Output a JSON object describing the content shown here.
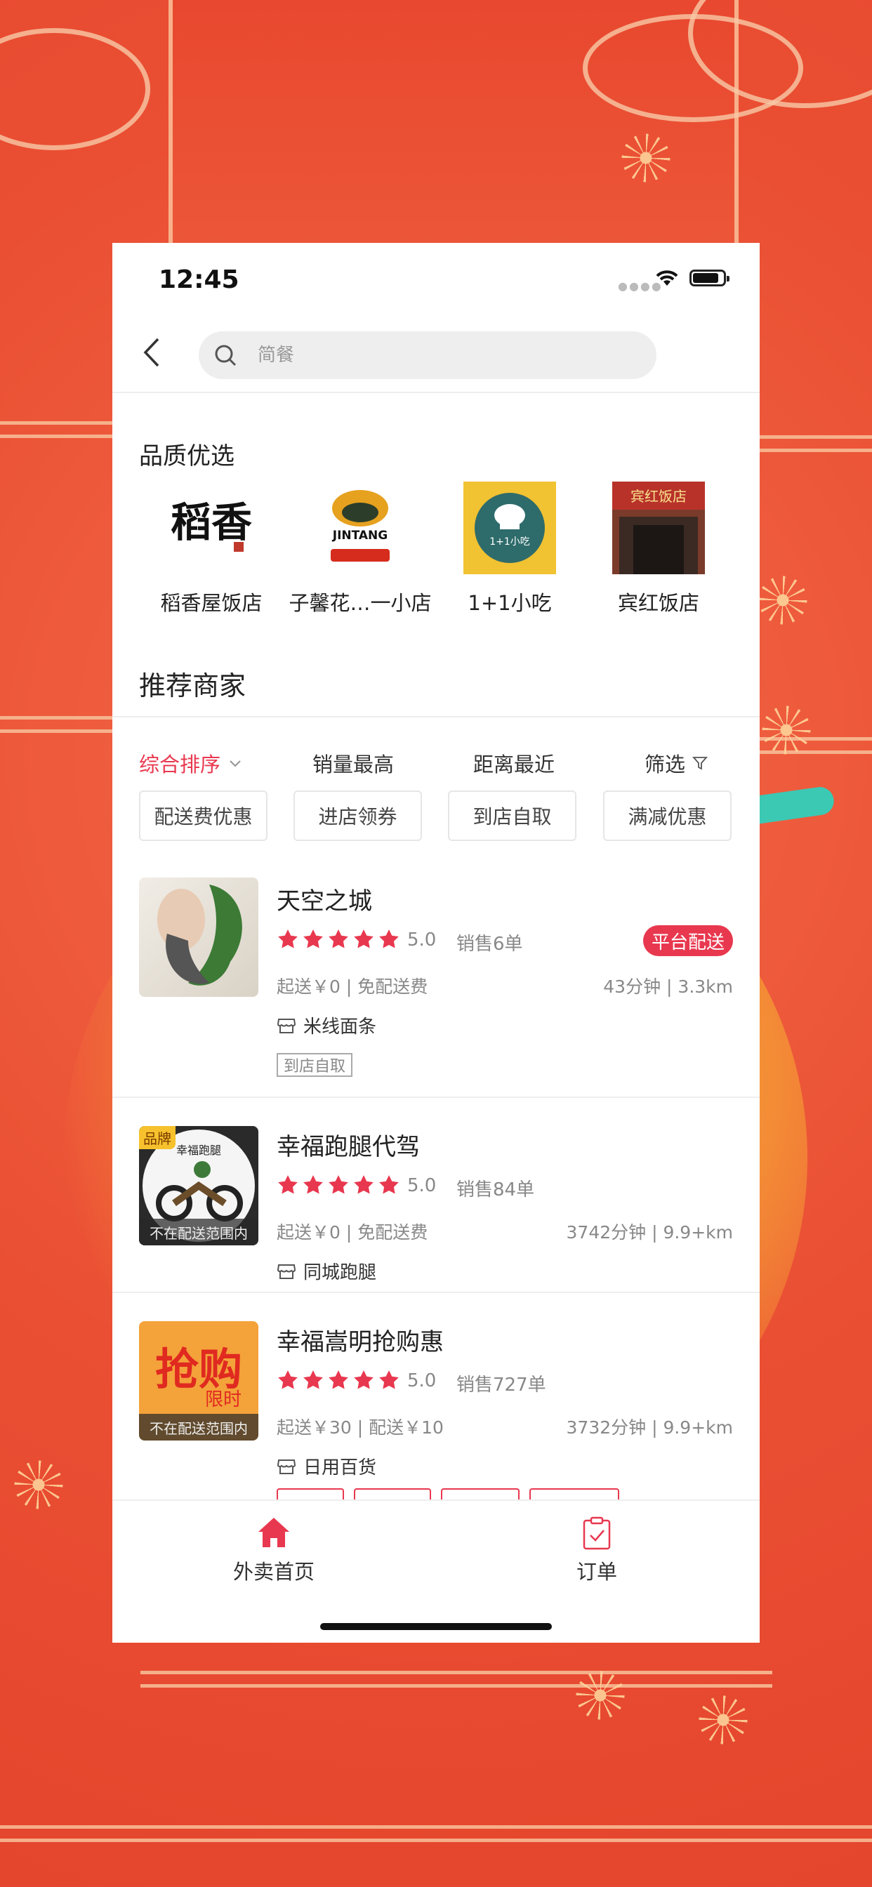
{
  "status_bar": {
    "time": "12:45"
  },
  "search": {
    "placeholder": "简餐"
  },
  "quality": {
    "title": "品质优选",
    "items": [
      {
        "name": "稻香屋饭店",
        "logo_text": "稻香"
      },
      {
        "name": "子馨花…一小店",
        "logo_text": "JINTANG"
      },
      {
        "name": "1+1小吃",
        "logo_text": "1+1小吃"
      },
      {
        "name": "宾红饭店",
        "logo_text": "宾红饭店"
      }
    ]
  },
  "recommend": {
    "title": "推荐商家",
    "sort": {
      "comprehensive": "综合排序",
      "sales": "销量最高",
      "distance": "距离最近",
      "filter": "筛选"
    },
    "chips": [
      "配送费优惠",
      "进店领券",
      "到店自取",
      "满减优惠"
    ],
    "stores": [
      {
        "name": "天空之城",
        "score": "5.0",
        "sales": "销售6单",
        "badge": "平台配送",
        "delivery": "起送￥0 | 免配送费",
        "eta": "43分钟 | 3.3km",
        "category": "米线面条",
        "tag": "到店自取",
        "logo_overlay": ""
      },
      {
        "name": "幸福跑腿代驾",
        "score": "5.0",
        "sales": "销售84单",
        "delivery": "起送￥0 | 免配送费",
        "eta": "3742分钟 | 9.9+km",
        "category": "同城跑腿",
        "brand": "品牌",
        "logo_text": "幸福跑腿",
        "logo_overlay": "不在配送范围内"
      },
      {
        "name": "幸福嵩明抢购惠",
        "score": "5.0",
        "sales": "销售727单",
        "delivery": "起送￥30 | 配送￥10",
        "eta": "3732分钟 | 9.9+km",
        "category": "日用百货",
        "logo_text": "抢购",
        "logo_sub": "限时",
        "logo_overlay": "不在配送范围内"
      }
    ]
  },
  "tabbar": {
    "home": "外卖首页",
    "orders": "订单"
  },
  "colors": {
    "accent": "#e8384f",
    "star": "#e8384f",
    "background": "#ea4f33"
  }
}
